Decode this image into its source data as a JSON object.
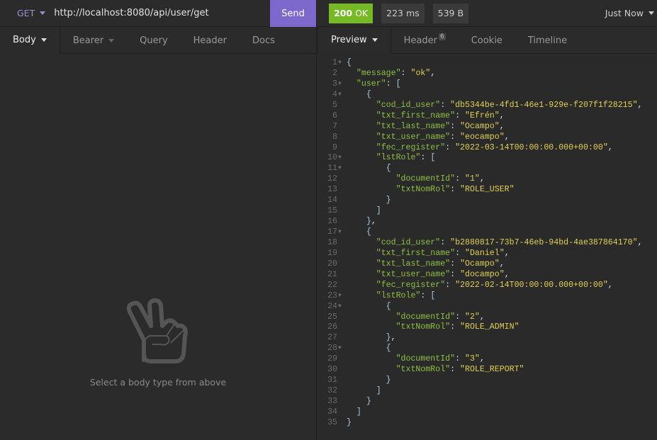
{
  "request": {
    "method": "GET",
    "url": "http://localhost:8080/api/user/get",
    "send_label": "Send",
    "tabs": [
      {
        "label": "Body",
        "active": true,
        "dropdown": true
      },
      {
        "label": "Bearer",
        "dropdown": true
      },
      {
        "label": "Query"
      },
      {
        "label": "Header"
      },
      {
        "label": "Docs"
      }
    ],
    "empty_message": "Select a body type from above",
    "empty_icon": "peace-hand-icon"
  },
  "response": {
    "status": "200",
    "status_text": "OK",
    "status_color": "#75ba24",
    "time": "223 ms",
    "size": "539 B",
    "history_label": "Just Now",
    "tabs": [
      {
        "label": "Preview",
        "active": true
      },
      {
        "label": "Header",
        "badge": "6"
      },
      {
        "label": "Cookie"
      },
      {
        "label": "Timeline"
      }
    ],
    "lines": [
      "{",
      "  \"message\": \"ok\",",
      "  \"user\": [",
      "    {",
      "      \"cod_id_user\": \"db5344be-4fd1-46e1-929e-f207f1f28215\",",
      "      \"txt_first_name\": \"Efrén\",",
      "      \"txt_last_name\": \"Ocampo\",",
      "      \"txt_user_name\": \"eocampo\",",
      "      \"fec_register\": \"2022-03-14T00:00:00.000+00:00\",",
      "      \"lstRole\": [",
      "        {",
      "          \"documentId\": \"1\",",
      "          \"txtNomRol\": \"ROLE_USER\"",
      "        }",
      "      ]",
      "    },",
      "    {",
      "      \"cod_id_user\": \"b2880817-73b7-46eb-94bd-4ae387864170\",",
      "      \"txt_first_name\": \"Daniel\",",
      "      \"txt_last_name\": \"Ocampo\",",
      "      \"txt_user_name\": \"docampo\",",
      "      \"fec_register\": \"2022-02-14T00:00:00.000+00:00\",",
      "      \"lstRole\": [",
      "        {",
      "          \"documentId\": \"2\",",
      "          \"txtNomRol\": \"ROLE_ADMIN\"",
      "        },",
      "        {",
      "          \"documentId\": \"3\",",
      "          \"txtNomRol\": \"ROLE_REPORT\"",
      "        }",
      "      ]",
      "    }",
      "  ]",
      "}"
    ]
  }
}
